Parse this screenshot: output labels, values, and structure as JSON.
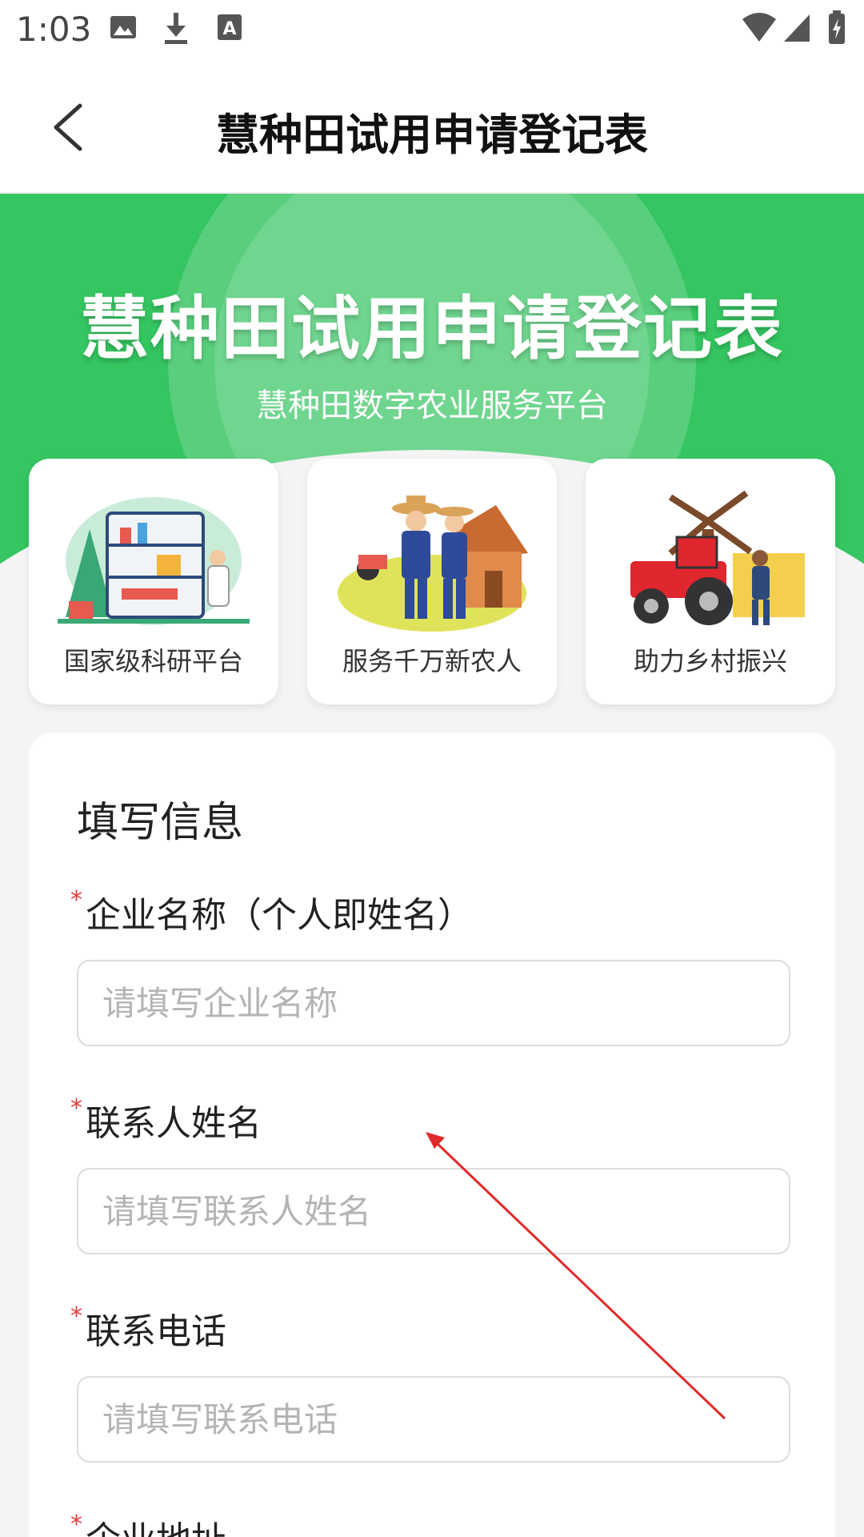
{
  "status_bar": {
    "time": "1:03"
  },
  "header": {
    "title": "慧种田试用申请登记表"
  },
  "banner": {
    "title": "慧种田试用申请登记表",
    "subtitle": "慧种田数字农业服务平台"
  },
  "features": [
    {
      "label": "国家级科研平台",
      "icon": "lab-illustration"
    },
    {
      "label": "服务千万新农人",
      "icon": "farmers-illustration"
    },
    {
      "label": "助力乡村振兴",
      "icon": "tractor-windmill-illustration"
    }
  ],
  "form": {
    "title": "填写信息",
    "required_mark": "*",
    "fields": [
      {
        "label": "企业名称（个人即姓名）",
        "placeholder": "请填写企业名称",
        "value": ""
      },
      {
        "label": "联系人姓名",
        "placeholder": "请填写联系人姓名",
        "value": ""
      },
      {
        "label": "联系电话",
        "placeholder": "请填写联系电话",
        "value": ""
      },
      {
        "label": "企业地址"
      }
    ]
  },
  "colors": {
    "brand_green": "#35c561",
    "required_red": "#e23a3a",
    "arrow_red": "#e02a2a"
  }
}
